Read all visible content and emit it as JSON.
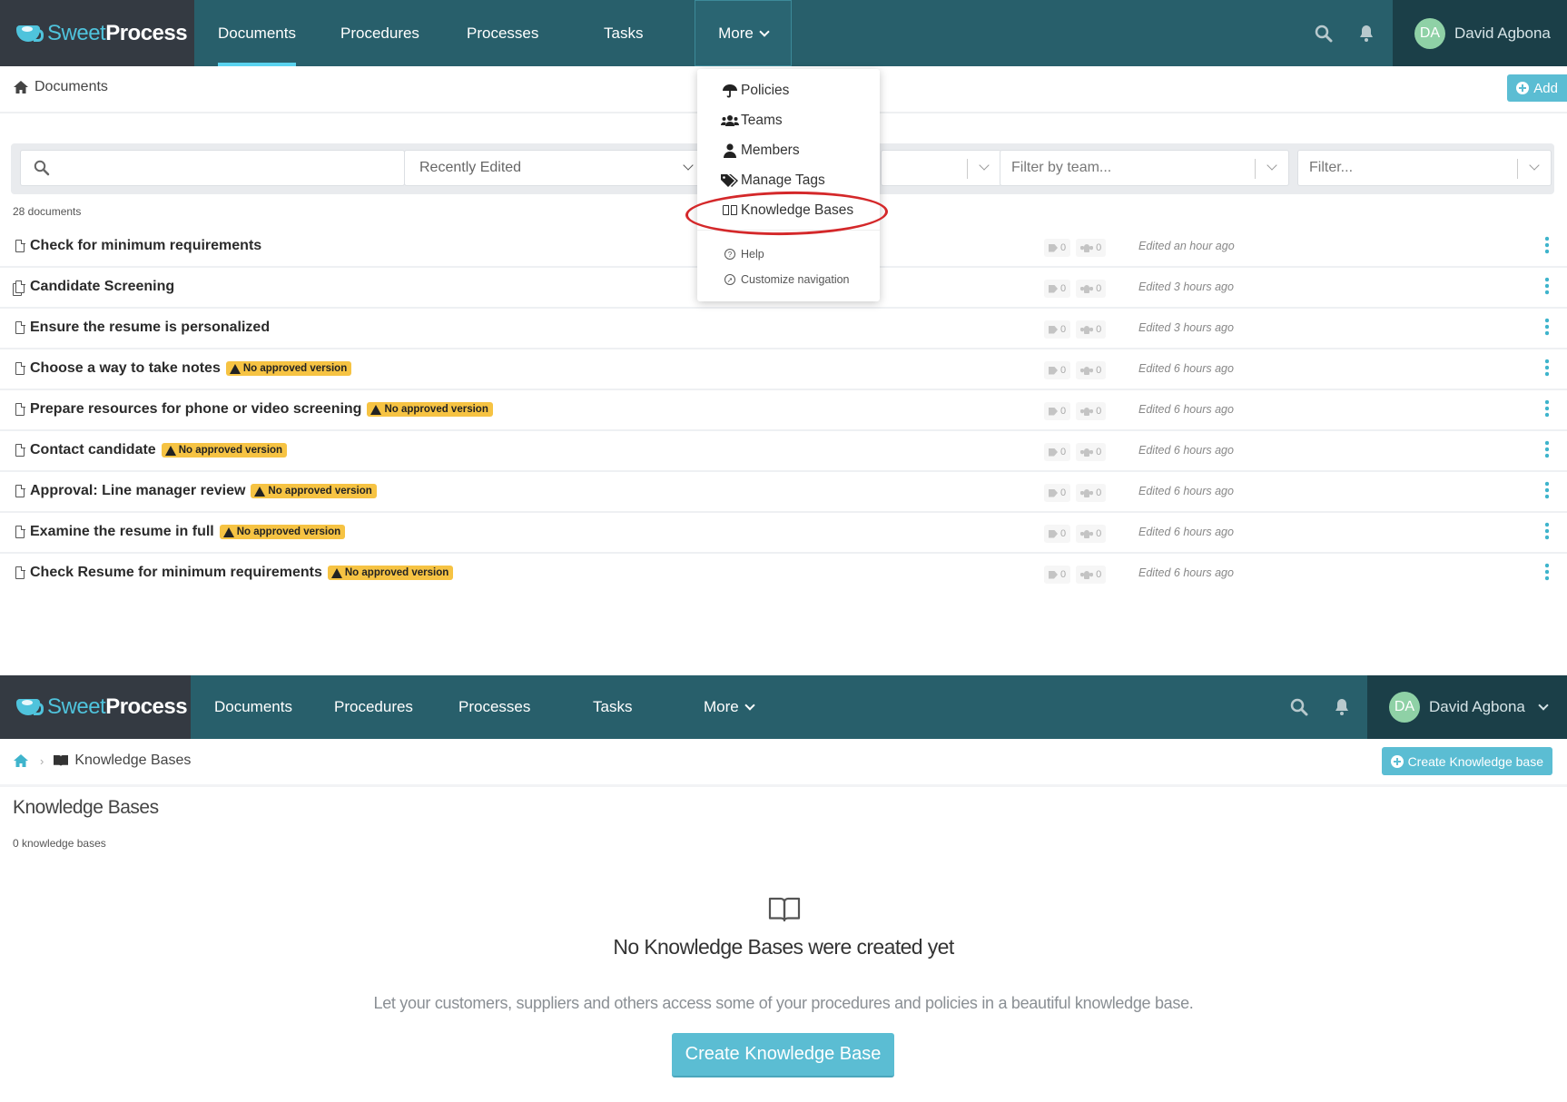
{
  "app": {
    "brand_part1": "Sweet",
    "brand_part2": "Process"
  },
  "top": {
    "nav": {
      "links": [
        "Documents",
        "Procedures",
        "Processes",
        "Tasks",
        "More"
      ],
      "active": "Documents",
      "user_initials": "DA",
      "user_name": "David Agbona"
    },
    "breadcrumb": "Documents",
    "add_button": "Add",
    "filters": {
      "search_placeholder": "",
      "sort_value": "Recently Edited",
      "team_placeholder": "Filter by team...",
      "filter_placeholder": "Filter..."
    },
    "count": "28 documents",
    "documents": [
      {
        "title": "Check for minimum requirements",
        "icon": "document-icon",
        "badge": "",
        "tags": "0",
        "teams": "0",
        "edited": "Edited an hour ago"
      },
      {
        "title": "Candidate Screening",
        "icon": "documents-copy-icon",
        "badge": "",
        "tags": "0",
        "teams": "0",
        "edited": "Edited 3 hours ago"
      },
      {
        "title": "Ensure the resume is personalized",
        "icon": "document-icon",
        "badge": "",
        "tags": "0",
        "teams": "0",
        "edited": "Edited 3 hours ago"
      },
      {
        "title": "Choose a way to take notes",
        "icon": "document-icon",
        "badge": "No approved version",
        "tags": "0",
        "teams": "0",
        "edited": "Edited 6 hours ago"
      },
      {
        "title": "Prepare resources for phone or video screening",
        "icon": "document-icon",
        "badge": "No approved version",
        "tags": "0",
        "teams": "0",
        "edited": "Edited 6 hours ago"
      },
      {
        "title": "Contact candidate",
        "icon": "document-icon",
        "badge": "No approved version",
        "tags": "0",
        "teams": "0",
        "edited": "Edited 6 hours ago"
      },
      {
        "title": "Approval: Line manager review",
        "icon": "document-icon",
        "badge": "No approved version",
        "tags": "0",
        "teams": "0",
        "edited": "Edited 6 hours ago"
      },
      {
        "title": "Examine the resume in full",
        "icon": "document-icon",
        "badge": "No approved version",
        "tags": "0",
        "teams": "0",
        "edited": "Edited 6 hours ago"
      },
      {
        "title": "Check Resume for minimum requirements",
        "icon": "document-icon",
        "badge": "No approved version",
        "tags": "0",
        "teams": "0",
        "edited": "Edited 6 hours ago"
      }
    ],
    "more_menu": {
      "items": [
        {
          "label": "Policies",
          "icon": "umbrella-icon"
        },
        {
          "label": "Teams",
          "icon": "users-icon"
        },
        {
          "label": "Members",
          "icon": "user-icon"
        },
        {
          "label": "Manage Tags",
          "icon": "tags-icon"
        },
        {
          "label": "Knowledge Bases",
          "icon": "book-open-icon",
          "highlighted": true
        }
      ],
      "secondary": [
        {
          "label": "Help",
          "icon": "question-circle-icon"
        },
        {
          "label": "Customize navigation",
          "icon": "compass-icon"
        }
      ]
    }
  },
  "bottom": {
    "nav": {
      "links": [
        "Documents",
        "Procedures",
        "Processes",
        "Tasks",
        "More"
      ],
      "user_initials": "DA",
      "user_name": "David Agbona"
    },
    "breadcrumb": "Knowledge Bases",
    "create_button": "Create Knowledge base",
    "heading": "Knowledge Bases",
    "count": "0 knowledge bases",
    "empty_title": "No Knowledge Bases were created yet",
    "empty_description": "Let your customers, suppliers and others access some of your procedures and policies in a beautiful knowledge base.",
    "empty_button": "Create Knowledge Base"
  },
  "colors": {
    "nav_bg": "#285f6b",
    "brand_bg": "#343a42",
    "user_bg": "#1b3f48",
    "accent": "#5bbdd3",
    "badge": "#f6c343",
    "highlight_ring": "#d4282a"
  }
}
